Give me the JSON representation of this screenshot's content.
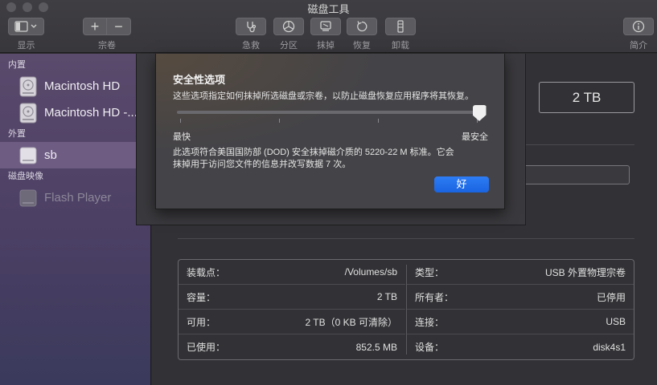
{
  "window": {
    "title": "磁盘工具"
  },
  "toolbar": {
    "view_label": "显示",
    "volume_label": "宗卷",
    "firstaid_label": "急救",
    "partition_label": "分区",
    "erase_label": "抹掉",
    "restore_label": "恢复",
    "unmount_label": "卸载",
    "info_label": "简介",
    "add_glyph": "+",
    "remove_glyph": "−"
  },
  "sidebar": {
    "sections": [
      {
        "title": "内置",
        "items": [
          {
            "label": "Macintosh HD"
          },
          {
            "label": "Macintosh HD -..."
          }
        ]
      },
      {
        "title": "外置",
        "items": [
          {
            "label": "sb"
          }
        ]
      },
      {
        "title": "磁盘映像",
        "items": [
          {
            "label": "Flash Player"
          }
        ]
      }
    ]
  },
  "main": {
    "capacity_badge": "2 TB"
  },
  "sheet": {
    "title": "安全性选项",
    "description": "这些选项指定如何抹掉所选磁盘或宗卷，以防止磁盘恢复应用程序将其恢复。",
    "min_label": "最快",
    "max_label": "最安全",
    "slider_level": 1.0,
    "note": "此选项符合美国国防部 (DOD) 安全抹掉磁介质的 5220-22 M 标准。它会抹掉用于访问您文件的信息并改写数据 7 次。",
    "ok_label": "好"
  },
  "info": {
    "left": [
      {
        "label": "装载点：",
        "value": "/Volumes/sb"
      },
      {
        "label": "容量：",
        "value": "2 TB"
      },
      {
        "label": "可用：",
        "value": "2 TB（0 KB 可清除）"
      },
      {
        "label": "已使用：",
        "value": "852.5 MB"
      }
    ],
    "right": [
      {
        "label": "类型：",
        "value": "USB 外置物理宗卷"
      },
      {
        "label": "所有者：",
        "value": "已停用"
      },
      {
        "label": "连接：",
        "value": "USB"
      },
      {
        "label": "设备：",
        "value": "disk4s1"
      }
    ]
  },
  "colors": {
    "accent": "#1a6ef0",
    "sidebar_selected": "#78648c"
  }
}
